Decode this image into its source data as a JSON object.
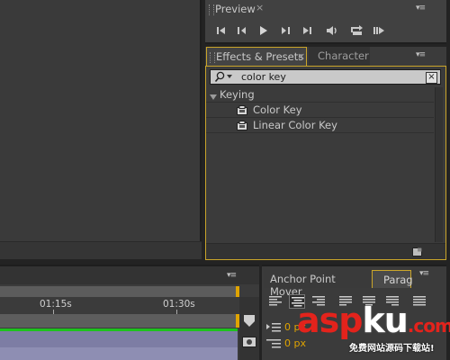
{
  "preview": {
    "title": "Preview",
    "close": "×",
    "menu": "▾≡",
    "controls": [
      "first-frame-icon",
      "previous-frame-icon",
      "play-icon",
      "next-frame-icon",
      "last-frame-icon",
      "audio-icon",
      "loop-icon",
      "ram-preview-icon"
    ]
  },
  "effects": {
    "tab_effects": "Effects & Presets",
    "tab_close": "×",
    "tab_character": "Character",
    "menu": "▾≡",
    "search_value": "color key",
    "search_clear": "×",
    "category": "Keying",
    "items": [
      "Color Key",
      "Linear Color Key"
    ]
  },
  "timeline": {
    "menu": "▾≡",
    "tick_labels": [
      "01:15s",
      "01:30s"
    ]
  },
  "paragraph": {
    "tab_anchor": "Anchor Point Mover",
    "tab_para": "Parag",
    "menu": "▾≡",
    "indent_values": [
      "0 px",
      "0 px"
    ]
  },
  "watermark": {
    "brand_a": "asp",
    "brand_b": "ku",
    "brand_c": ".com",
    "tagline": "免费网站源码下载站!"
  },
  "colors": {
    "accent": "#caa52a",
    "playhead": "#e0a400",
    "track_green": "#1ec21e",
    "track_purple": "#7d7da4"
  }
}
